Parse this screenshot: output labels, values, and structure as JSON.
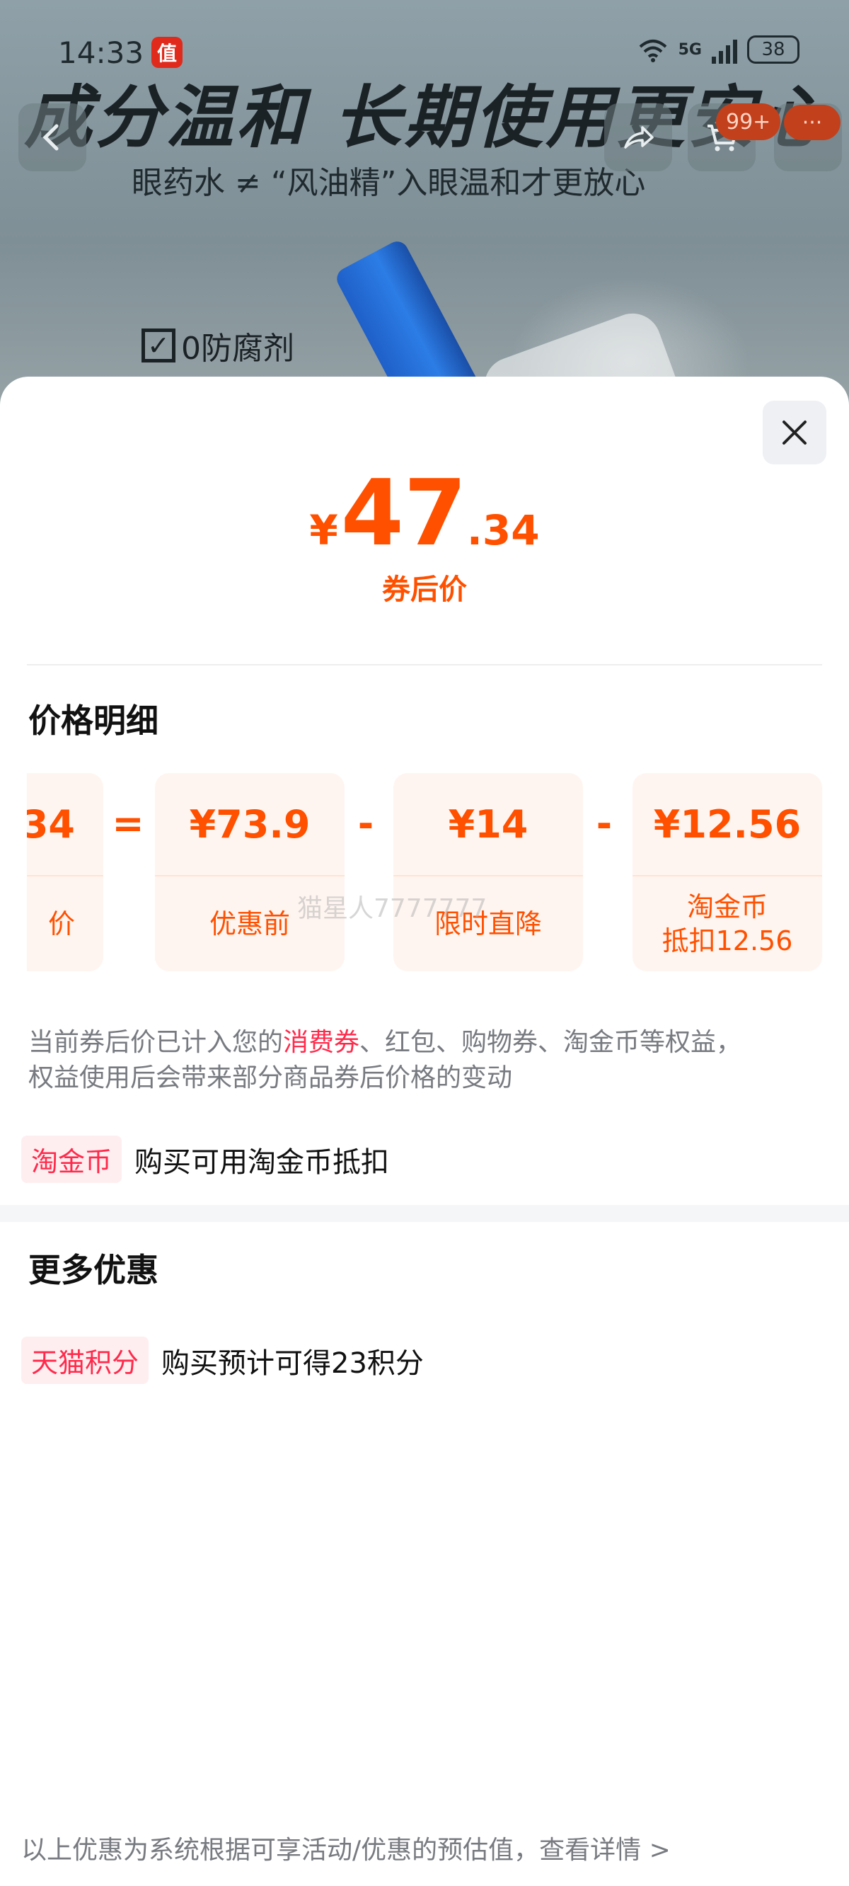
{
  "status_bar": {
    "time": "14:33",
    "app_icon_char": "值",
    "signal_text": "5G",
    "wifi_sub": "6",
    "battery": "38"
  },
  "banner": {
    "heading": "成分温和  长期使用更安心",
    "subheading": "眼药水 ≠ “风油精”入眼温和才更放心",
    "check_label": "0防腐剂"
  },
  "nav": {
    "cart_badge": "99+",
    "more_badge": "···"
  },
  "price": {
    "symbol": "¥",
    "integer": "47",
    "decimal": ".34",
    "caption": "券后价"
  },
  "price_detail": {
    "title": "价格明细",
    "first_card": {
      "value": "34",
      "label": "价"
    },
    "operators": [
      "=",
      "-",
      "-"
    ],
    "cards": [
      {
        "value": "¥73.9",
        "label": "优惠前"
      },
      {
        "value": "¥14",
        "label": "限时直降"
      },
      {
        "value": "¥12.56",
        "label_line1": "淘金币",
        "label_line2": "抵扣12.56"
      }
    ]
  },
  "watermark": "猫星人7777777",
  "note": {
    "part1": "当前券后价已计入您的",
    "highlight": "消费券",
    "part2": "、红包、购物券、淘金币等权益，",
    "line2": "权益使用后会带来部分商品券后价格的变动"
  },
  "taojinbi_row": {
    "tag": "淘金币",
    "text": "购买可用淘金币抵扣"
  },
  "more_deals": {
    "title": "更多优惠",
    "row": {
      "tag": "天猫积分",
      "text": "购买预计可得23积分"
    }
  },
  "footer": "以上优惠为系统根据可享活动/优惠的预估值，查看详情 >",
  "colors": {
    "accent": "#ff5000",
    "highlight": "#ff2a4b"
  }
}
